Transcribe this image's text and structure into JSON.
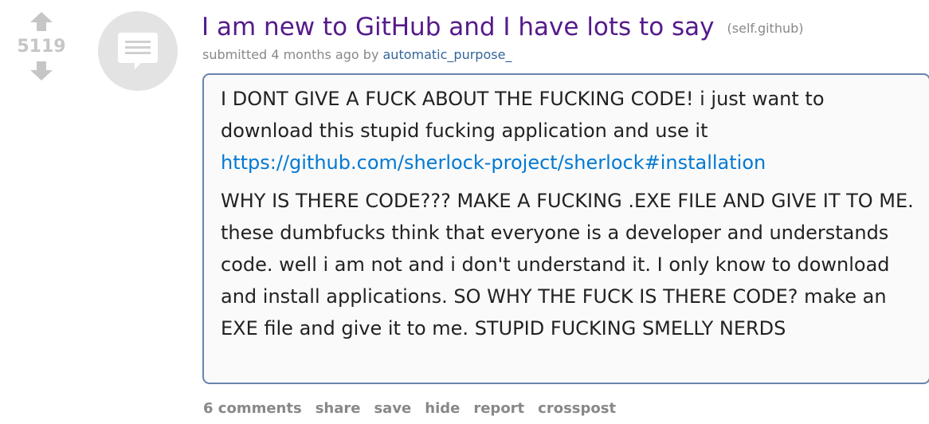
{
  "vote": {
    "score": "5119"
  },
  "thumbnail": {
    "icon": "self-post-icon"
  },
  "post": {
    "title": "I am new to GitHub and I have lots to say",
    "domain": "(self.github)",
    "tagline_prefix": "submitted",
    "time": "4 months ago",
    "by": "by",
    "author": "automatic_purpose_"
  },
  "selftext": {
    "paragraph1": "I DONT GIVE A FUCK ABOUT THE FUCKING CODE! i just want to download this stupid fucking application and use it",
    "link": "https://github.com/sherlock-project/sherlock#installation",
    "paragraph2": "WHY IS THERE CODE??? MAKE A FUCKING .EXE FILE AND GIVE IT TO ME. these dumbfucks think that everyone is a developer and understands code. well i am not and i don't understand it. I only know to download and install applications. SO WHY THE FUCK IS THERE CODE? make an EXE file and give it to me. STUPID FUCKING SMELLY NERDS"
  },
  "actions": {
    "comments": "6 comments",
    "share": "share",
    "save": "save",
    "hide": "hide",
    "report": "report",
    "crosspost": "crosspost"
  },
  "colors": {
    "title": "#551a8b",
    "author": "#336699",
    "link": "#0079d3",
    "box_border": "#6983ac",
    "muted": "#888888",
    "score": "#c6c6c6",
    "thumb_bg": "#e3e3e3"
  }
}
